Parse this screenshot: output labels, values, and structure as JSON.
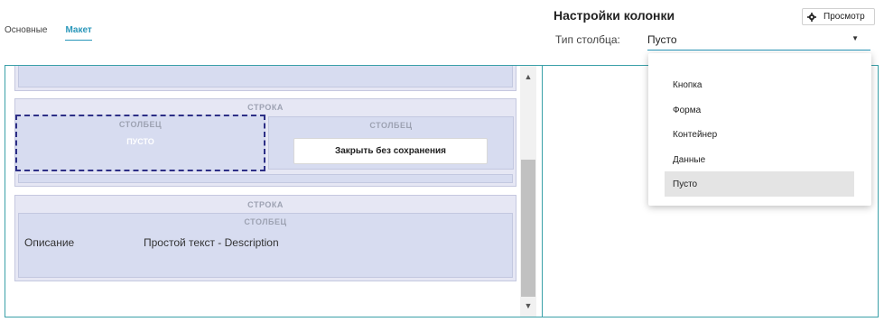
{
  "header": {
    "preview_label": "Просмотр",
    "tabs": [
      {
        "label": "Основные",
        "active": false
      },
      {
        "label": "Макет",
        "active": true
      }
    ]
  },
  "canvas": {
    "row_label": "СТРОКА",
    "column_label": "СТОЛБЕЦ",
    "empty_label": "ПУСТО",
    "close_button_label": "Закрыть без сохранения",
    "field_label": "Описание",
    "field_value": "Простой текст - Description"
  },
  "settings": {
    "title": "Настройки колонки",
    "column_type_label": "Тип столбца:",
    "column_type_value": "Пусто",
    "options": [
      "Кнопка",
      "Форма",
      "Контейнер",
      "Данные",
      "Пусто"
    ],
    "selected_option": "Пусто"
  },
  "colors": {
    "accent": "#2a97ba",
    "frame": "#3aa0a8",
    "row_bg": "#e6e7f4",
    "column_bg": "#d7dcf0",
    "selection_border": "#2d2f86"
  }
}
